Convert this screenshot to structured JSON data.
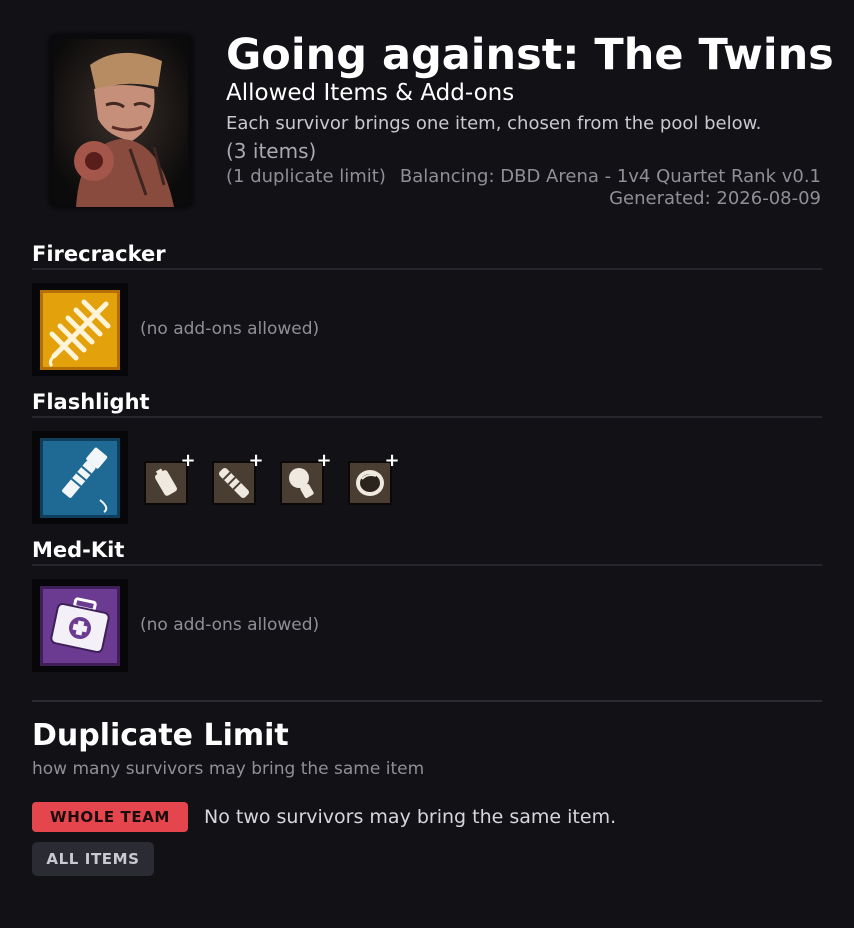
{
  "header": {
    "title": "Going against: The Twins",
    "subtitle": "Allowed Items & Add-ons",
    "description": "Each survivor brings one item, chosen from the pool below.",
    "item_count": "(3 items)",
    "duplicate_note": "(1 duplicate limit)",
    "balancing": "Balancing: DBD Arena - 1v4 Quartet Rank v0.1",
    "generated": "Generated: 2026-08-09",
    "portrait_icon": "killer-portrait-the-twins"
  },
  "items": [
    {
      "name": "Firecracker",
      "icon": "firecracker-icon",
      "icon_color": "#e3a20c",
      "no_addons": "(no add-ons allowed)",
      "addons": []
    },
    {
      "name": "Flashlight",
      "icon": "flashlight-icon",
      "icon_color": "#1e6a94",
      "addons": [
        {
          "icon": "battery-addon-icon"
        },
        {
          "icon": "grip-addon-icon"
        },
        {
          "icon": "bulb-addon-icon"
        },
        {
          "icon": "lens-addon-icon"
        }
      ]
    },
    {
      "name": "Med-Kit",
      "icon": "medkit-icon",
      "icon_color": "#6b3b92",
      "no_addons": "(no add-ons allowed)",
      "addons": []
    }
  ],
  "duplicate_limit": {
    "title": "Duplicate Limit",
    "subtitle": "how many survivors may bring the same item",
    "scope_badge": "WHOLE TEAM",
    "rule": "No two survivors may bring the same item.",
    "items_badge": "ALL ITEMS",
    "accent": "#e5454d"
  }
}
